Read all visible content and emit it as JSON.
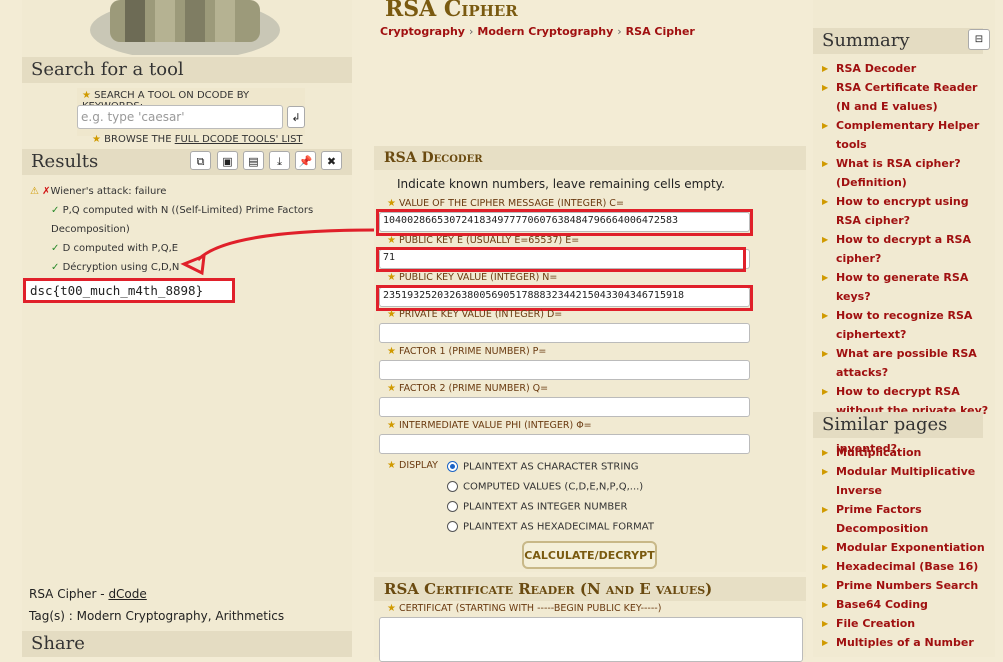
{
  "left": {
    "search_title": "Search for a tool",
    "search_hint": "SEARCH A TOOL ON DCODE BY KEYWORDS:",
    "search_placeholder": "e.g. type 'caesar'",
    "browse_prefix": "BROWSE THE",
    "browse_link": "FULL DCODE TOOLS' LIST",
    "results_title": "Results",
    "results": [
      "Wiener's attack: failure",
      "P,Q computed with N ((Self-Limited) Prime Factors",
      "Decomposition)",
      "D computed with P,Q,E",
      "Décryption using C,D,N"
    ],
    "flag": "dsc{t00_much_m4th_8898}",
    "footer_tool": "RSA Cipher -",
    "footer_link": "dCode",
    "tags": "Tag(s) : Modern Cryptography, Arithmetics",
    "share_title": "Share"
  },
  "center": {
    "title": "RSA Cipher",
    "breadcrumbs": [
      "Cryptography",
      "Modern Cryptography",
      "RSA Cipher"
    ],
    "decoder_title": "RSA Decoder",
    "intro": "Indicate known numbers, leave remaining cells empty.",
    "fields": {
      "c_label": "VALUE OF THE CIPHER MESSAGE (INTEGER) C=",
      "c_value": "1040028665307241834977770607638484796664006472583",
      "e_label": "PUBLIC KEY E (USUALLY E=65537) E=",
      "e_value": "71",
      "n_label": "PUBLIC KEY VALUE (INTEGER) N=",
      "n_value": "23519325203263800569051788832344215043304346715918",
      "d_label": "PRIVATE KEY VALUE (INTEGER) D=",
      "p_label": "FACTOR 1 (PRIME NUMBER) P=",
      "q_label": "FACTOR 2 (PRIME NUMBER) Q=",
      "phi_label": "INTERMEDIATE VALUE PHI (INTEGER) Φ="
    },
    "display_label": "DISPLAY",
    "display_options": [
      "PLAINTEXT AS CHARACTER STRING",
      "COMPUTED VALUES (C,D,E,N,P,Q,...)",
      "PLAINTEXT AS INTEGER NUMBER",
      "PLAINTEXT AS HEXADECIMAL FORMAT"
    ],
    "button": "CALCULATE/DECRYPT",
    "cert_title": "RSA Certificate Reader (N and E values)",
    "cert_label": "CERTIFICAT (STARTING WITH -----BEGIN PUBLIC KEY-----)"
  },
  "right": {
    "summary_title": "Summary",
    "summary_items": [
      "RSA Decoder",
      "RSA Certificate Reader (N and E values)",
      "Complementary Helper tools",
      "What is RSA cipher? (Definition)",
      "How to encrypt using RSA cipher?",
      "How to decrypt a RSA cipher?",
      "How to generate RSA keys?",
      "How to recognize RSA ciphertext?",
      "What are possible RSA attacks?",
      "How to decrypt RSA without the private key?",
      "When RSA was invented?"
    ],
    "similar_title": "Similar pages",
    "similar_items": [
      "Multiplication",
      "Modular Multiplicative Inverse",
      "Prime Factors Decomposition",
      "Modular Exponentiation",
      "Hexadecimal (Base 16)",
      "Prime Numbers Search",
      "Base64 Coding",
      "File Creation",
      "Multiples of a Number"
    ]
  },
  "colors": {
    "accent": "#a01010",
    "highlight": "#e0202a",
    "gold": "#d09a00"
  }
}
